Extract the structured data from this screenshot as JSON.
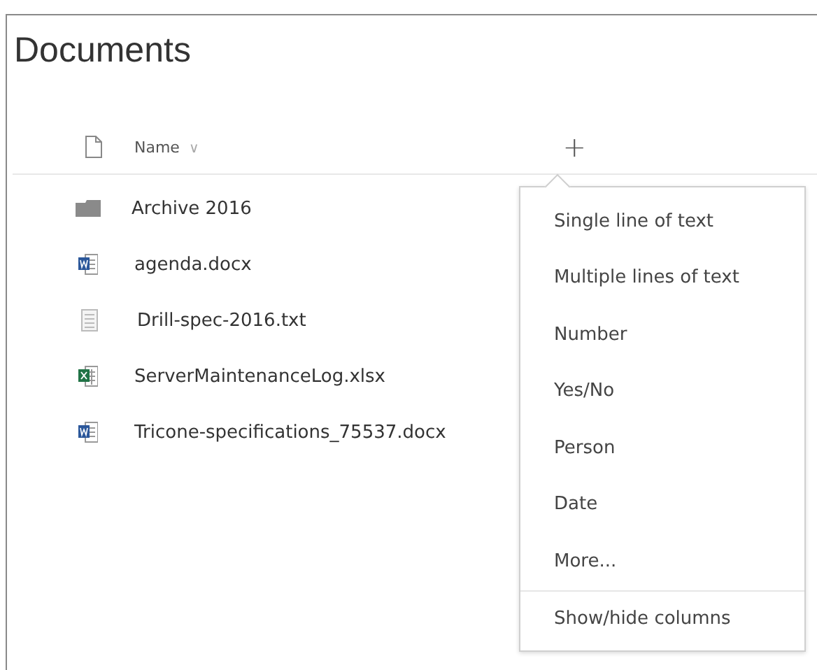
{
  "title": "Documents",
  "header": {
    "name_label": "Name",
    "sort_caret": "∨",
    "add_column": "+"
  },
  "files": [
    {
      "name": "Archive 2016",
      "kind": "folder"
    },
    {
      "name": "agenda.docx",
      "kind": "word"
    },
    {
      "name": "Drill-spec-2016.txt",
      "kind": "text"
    },
    {
      "name": "ServerMaintenanceLog.xlsx",
      "kind": "excel"
    },
    {
      "name": "Tricone-specifications_75537.docx",
      "kind": "word"
    }
  ],
  "column_menu": {
    "items": [
      "Single line of text",
      "Multiple lines of text",
      "Number",
      "Yes/No",
      "Person",
      "Date",
      "More..."
    ],
    "footer_item": "Show/hide columns"
  }
}
